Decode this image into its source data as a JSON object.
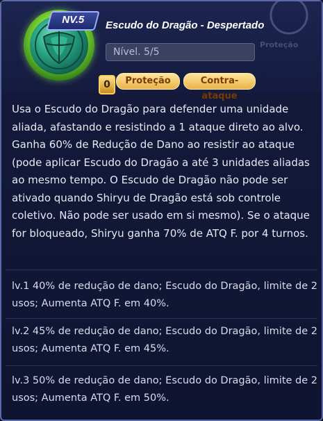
{
  "skill": {
    "level_badge": "NV.5",
    "gem_count": "0",
    "title": "Escudo do Dragão - Despertado",
    "level_text": "Nível. 5/5",
    "tags": [
      "Proteção",
      "Contra-ataque"
    ],
    "ghost_text": "Proteção"
  },
  "description": "Usa o Escudo do Dragão para defender uma unidade aliada, afastando e resistindo a 1 ataque direto ao alvo. Ganha 60% de Redução de Dano ao resistir ao ataque (pode aplicar Escudo do Dragão a até 3 unidades aliadas ao mesmo tempo. O Escudo de Dragão não pode ser ativado quando Shiryu de Dragão está sob controle coletivo. Não pode ser usado em si mesmo). Se o ataque for bloqueado, Shiryu ganha 70% de ATQ F. por 4 turnos.",
  "levels": [
    "lv.1 40% de redução de dano; Escudo do Dragão, limite de 2 usos; Aumenta ATQ F. em 40%.",
    "lv.2 45% de redução de dano; Escudo do Dragão, limite de 2 usos; Aumenta ATQ F. em 45%.",
    "lv.3 50% de redução de dano; Escudo do Dragão, limite de 2 usos; Aumenta ATQ F. em 50%."
  ],
  "colors": {
    "accent_gold": "#e8b34a",
    "panel_bg": "#14193a",
    "gem_green": "#7bd32e"
  }
}
